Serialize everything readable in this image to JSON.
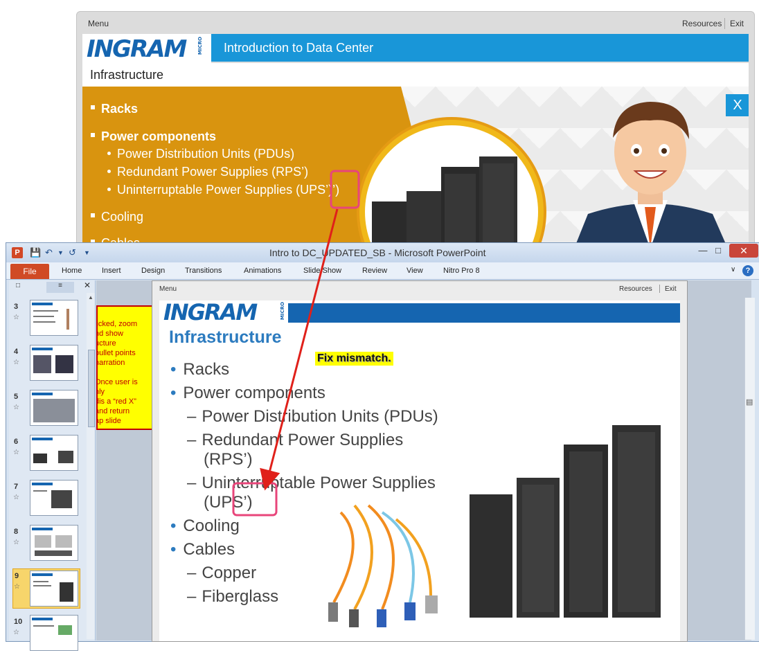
{
  "player": {
    "menu": "Menu",
    "resources": "Resources",
    "exit": "Exit",
    "logo": "INGRAM",
    "logo_micro": "MICRO",
    "course_title": "Introduction to Data Center",
    "section_title": "Infrastructure",
    "close_label": "X",
    "bullets": [
      {
        "text": "Racks",
        "level": 1
      },
      {
        "text": "Power components",
        "level": 1
      },
      {
        "text": "Power Distribution Units (PDUs)",
        "level": 2
      },
      {
        "text": "Redundant Power Supplies (RPS’)",
        "level": 2
      },
      {
        "text": "Uninterruptable Power Supplies (UPS’)’)",
        "level": 2
      },
      {
        "text": "Cooling",
        "level": 1
      },
      {
        "text": "Cables",
        "level": 1
      }
    ]
  },
  "ppt": {
    "window_title": "Intro to DC_UPDATED_SB  -  Microsoft PowerPoint",
    "tabs": [
      "File",
      "Home",
      "Insert",
      "Design",
      "Transitions",
      "Animations",
      "Slide Show",
      "Review",
      "View",
      "Nitro Pro 8"
    ],
    "thumbnails": [
      {
        "num": "3"
      },
      {
        "num": "4"
      },
      {
        "num": "5"
      },
      {
        "num": "6"
      },
      {
        "num": "7"
      },
      {
        "num": "8"
      },
      {
        "num": "9",
        "selected": true
      },
      {
        "num": "10"
      }
    ],
    "note_lines": [
      "licked, zoom",
      "nd show",
      "ucture",
      "bullet points",
      "narration",
      "",
      "Once user is",
      "nly",
      "dis a “red X”",
      "and return",
      "ap slide"
    ]
  },
  "slide": {
    "menu": "Menu",
    "resources": "Resources",
    "exit": "Exit",
    "logo": "INGRAM",
    "logo_micro": "MICRO",
    "title": "Infrastructure",
    "bullets": [
      {
        "text": "Racks",
        "level": 1
      },
      {
        "text": "Power components",
        "level": 1
      },
      {
        "text": "Power Distribution Units (PDUs)",
        "level": 2
      },
      {
        "text": "Redundant Power Supplies",
        "level": 2
      },
      {
        "text": "(RPS’)",
        "level": 3
      },
      {
        "text": "Uninterruptable Power Supplies",
        "level": 2
      },
      {
        "text": "(UPS’)",
        "level": 3
      },
      {
        "text": "Cooling",
        "level": 1
      },
      {
        "text": "Cables",
        "level": 1
      },
      {
        "text": "Copper",
        "level": 2
      },
      {
        "text": "Fiberglass",
        "level": 2
      }
    ]
  },
  "annotation": {
    "label": "Fix mismatch.",
    "arrow_color": "#e0201a",
    "highlight_color": "#e8457a"
  },
  "colors": {
    "brand_blue": "#1565b0",
    "course_blue": "#1996d8",
    "orange": "#d9940f",
    "ppt_file_tab": "#d04a25"
  }
}
